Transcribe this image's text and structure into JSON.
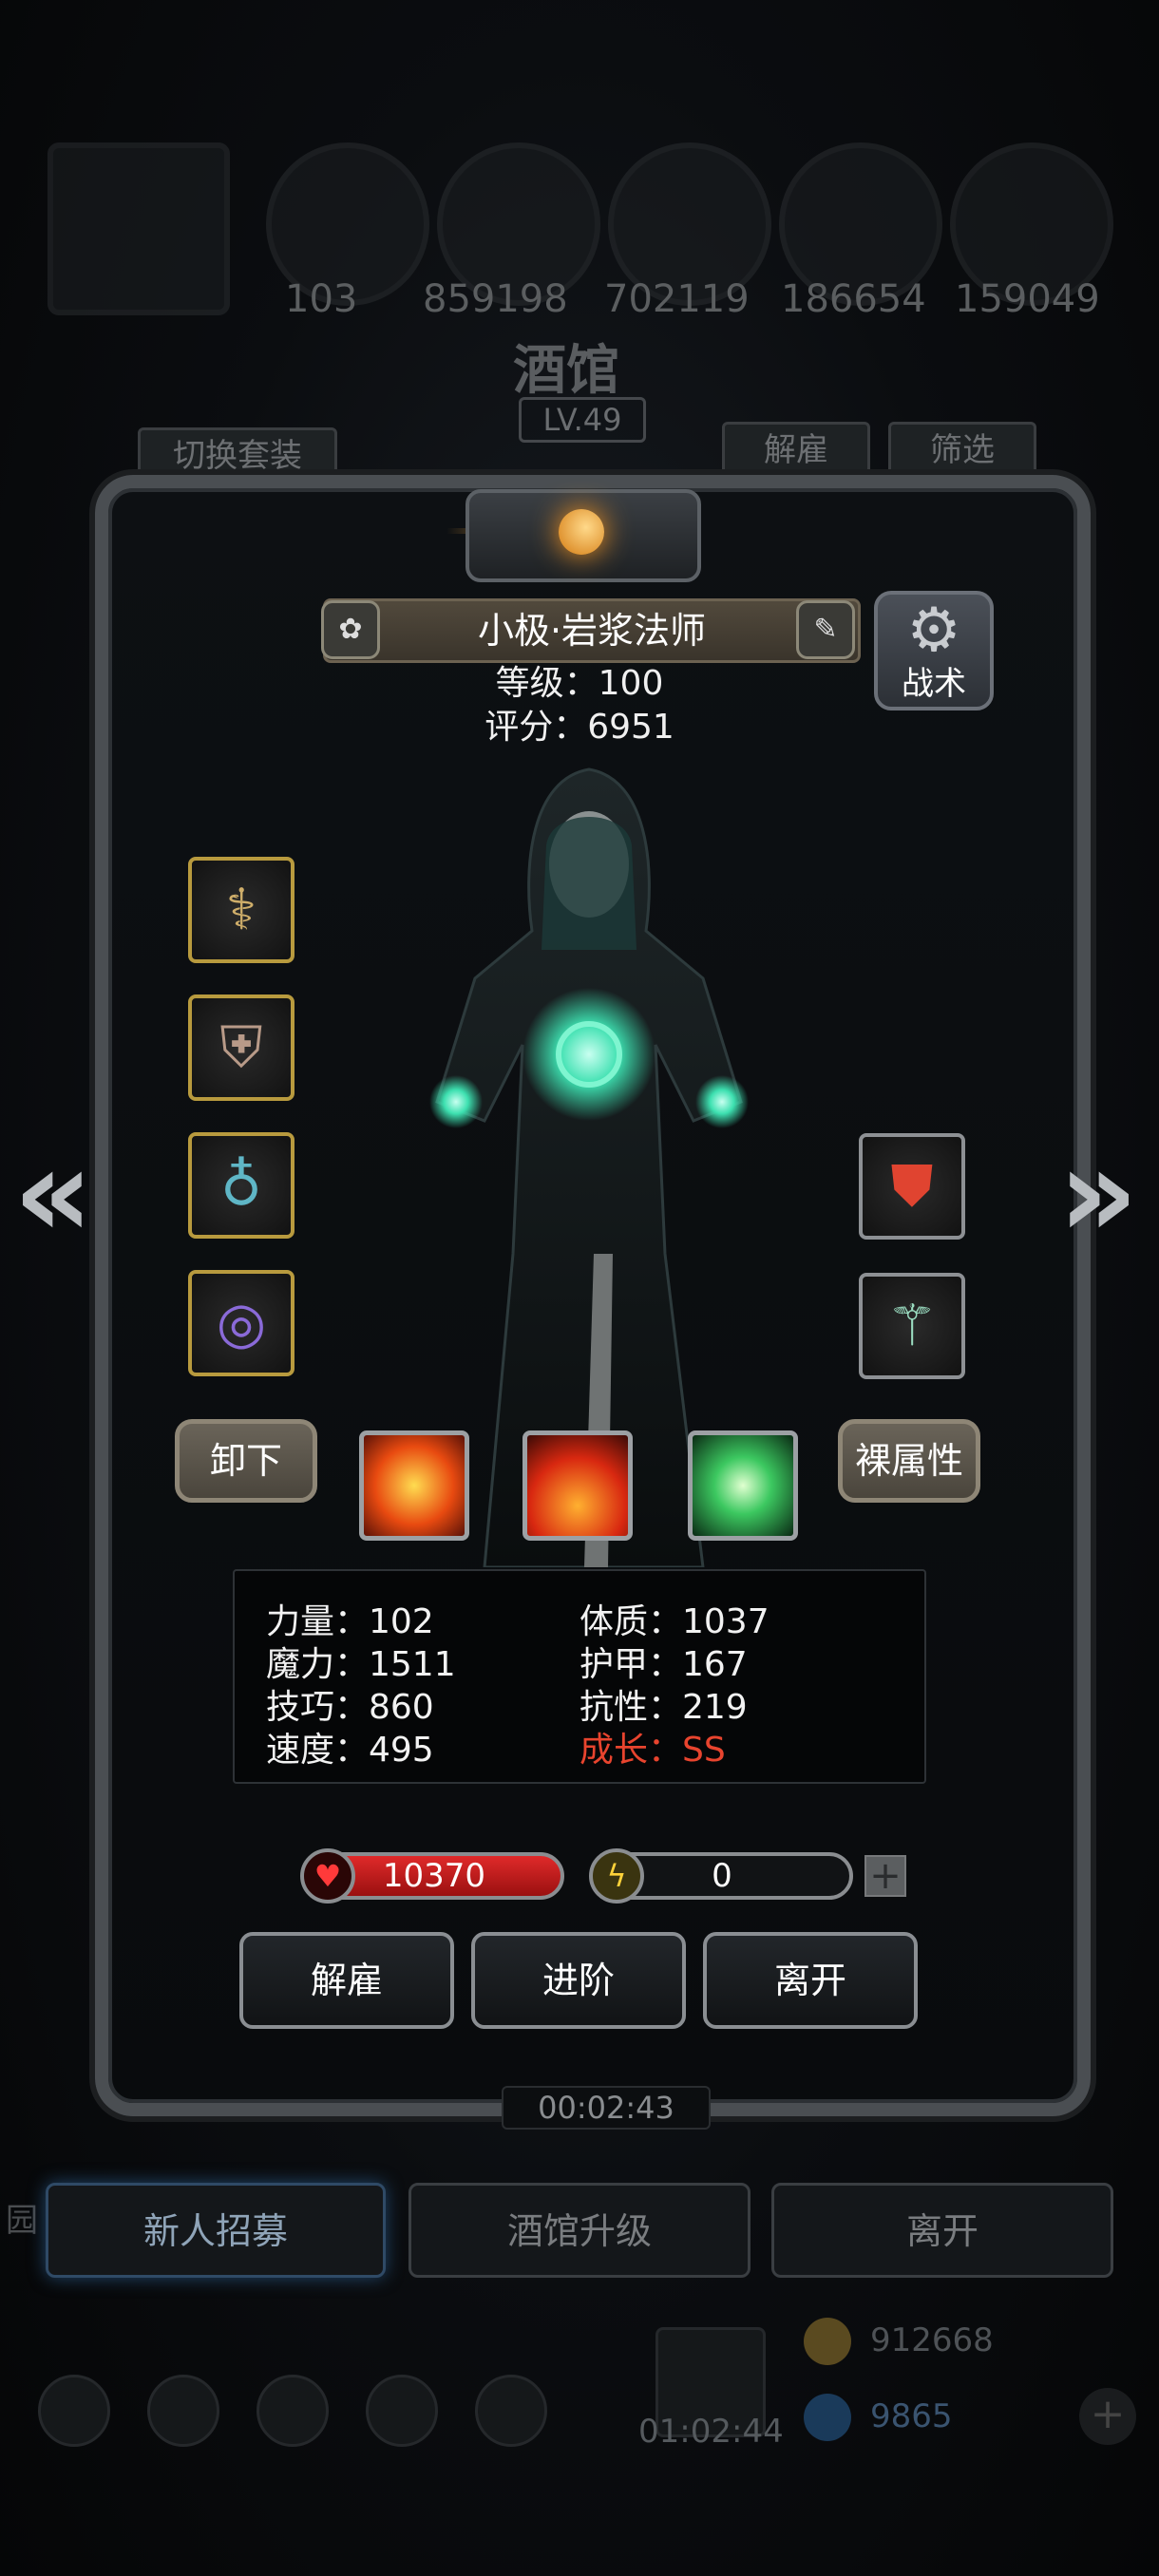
{
  "background": {
    "resources": [
      "103",
      "859198",
      "702119",
      "186654",
      "159049"
    ],
    "title": "酒馆",
    "level": "LV.49",
    "switch_outfit": "切换套装",
    "dismiss_top": "解雇",
    "filter": "筛选",
    "timer": "00:02:43",
    "recruit": "新人招募",
    "upgrade": "酒馆升级",
    "leave": "离开",
    "gold": "912668",
    "gems": "9865",
    "timer2": "01:02:44",
    "side_label": "园"
  },
  "hero": {
    "name": "小极·岩浆法师",
    "level_line": "等级：100",
    "score_line": "评分：6951",
    "tactic_label": "战术"
  },
  "equipment": {
    "left": [
      {
        "icon": "staff-icon"
      },
      {
        "icon": "armor-icon"
      },
      {
        "icon": "amulet-icon"
      },
      {
        "icon": "ring-icon"
      }
    ],
    "right": [
      {
        "icon": "emblem-icon"
      },
      {
        "icon": "wand-icon"
      }
    ]
  },
  "actions": {
    "unequip": "卸下",
    "base_attr": "裸属性",
    "skills": [
      "fire-burst-icon",
      "flame-icon",
      "green-spirit-icon"
    ]
  },
  "stats": {
    "strength": "力量：102",
    "magic": "魔力：1511",
    "skill": "技巧：860",
    "speed": "速度：495",
    "constitution": "体质：1037",
    "armor": "护甲：167",
    "resistance": "抗性：219",
    "growth": "成长：SS"
  },
  "bars": {
    "hp": "10370",
    "energy": "0"
  },
  "buttons": {
    "dismiss": "解雇",
    "advance": "进阶",
    "leave": "离开"
  },
  "colors": {
    "growth": "#e8442e",
    "hp_bar": "#c81e1e",
    "slot_gold": "#b89a3e"
  }
}
